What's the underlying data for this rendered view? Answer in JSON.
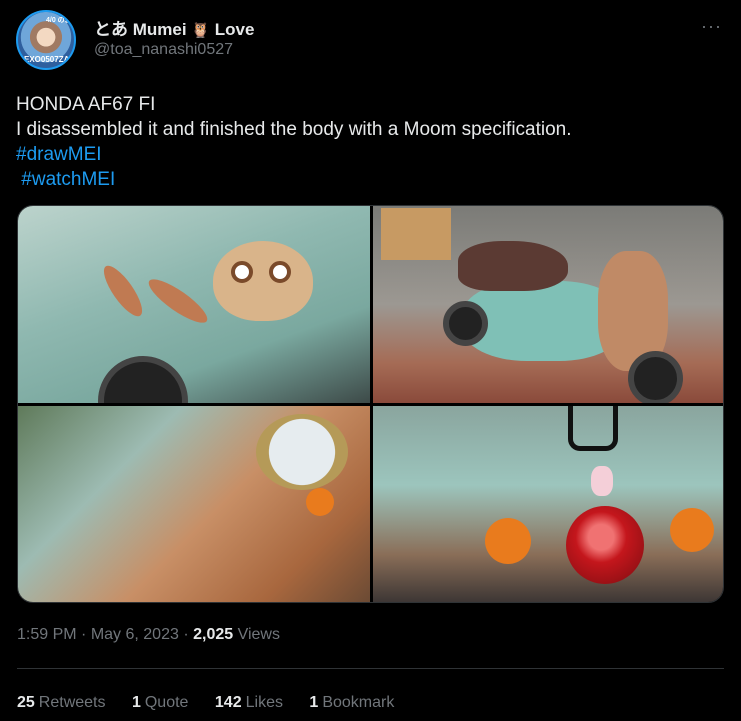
{
  "author": {
    "display_name": "とあ Mumei 🦉 Love",
    "display_name_prefix": "とあ Mumei",
    "display_name_emoji": "🦉",
    "display_name_suffix": "Love",
    "handle": "@toa_nanashi0527",
    "avatar_text_bottom": "EXO0507ZA",
    "avatar_text_top": "4/0 のよ"
  },
  "menu": {
    "more_label": "···",
    "more_icon": "more-horizontal-icon"
  },
  "tweet": {
    "line1": "HONDA AF67 FI",
    "line2": "I disassembled it and finished the body with a Moom specification.",
    "hashtag1": "#drawMEI",
    "hashtag2": " #watchMEI"
  },
  "media": {
    "photos": [
      {
        "label": "photo-1"
      },
      {
        "label": "photo-2"
      },
      {
        "label": "photo-3"
      },
      {
        "label": "photo-4"
      }
    ]
  },
  "meta": {
    "time": "1:59 PM",
    "separator": " · ",
    "date": "May 6, 2023",
    "views_count": "2,025",
    "views_label": " Views"
  },
  "stats": {
    "retweets": {
      "count": "25",
      "label": "Retweets"
    },
    "quotes": {
      "count": "1",
      "label": "Quote"
    },
    "likes": {
      "count": "142",
      "label": "Likes"
    },
    "bookmarks": {
      "count": "1",
      "label": "Bookmark"
    }
  },
  "colors": {
    "background": "#000000",
    "text": "#e7e9ea",
    "muted": "#71767b",
    "link": "#1d9bf0",
    "divider": "#2f3336"
  }
}
